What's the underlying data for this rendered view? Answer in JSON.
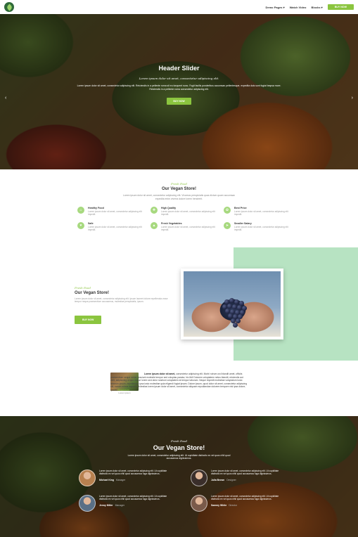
{
  "nav": {
    "items": [
      "Demo Pages ▾",
      "Watch Video",
      "Blocks ▾"
    ],
    "cta": "BUY NOW"
  },
  "hero": {
    "title": "Header Slider",
    "subtitle": "Lorem ipsum dolor sit amet, consectetur adipiscing elit.",
    "text": "Lorem ipsum dolor sit amet, consectetur adipiscing elit. Reiciendis in a pellente roma sit eu torquent nunc. Fugit facilis ponderibus accumsan pellentesque, expedita duis sunt fugiat leapsa more. Reiciendis in a pellente roma consectetur adipiscing elit.",
    "button": "BUY NOW",
    "prev_arrow": "‹",
    "next_arrow": "›"
  },
  "features": {
    "eyebrow": "Fresh Food",
    "title": "Our Vegan Store!",
    "desc": "Lorem ipsum dolor sit amet, consectetur adipiscing elit. Vivamus perspiciatis quas dictum quam accumsan expedita enim viverra dolore lorem hendrerit.",
    "items": [
      {
        "icon": "⌂",
        "title": "Healthy Food",
        "text": "Lorem ipsum dolor sit amet, consectetur adipiscing elit impedit."
      },
      {
        "icon": "✚",
        "title": "High Quality",
        "text": "Lorem ipsum dolor sit amet, consectetur adipiscing elit impedit."
      },
      {
        "icon": "✿",
        "title": "Best Price",
        "text": "Lorem ipsum dolor sit amet, consectetur adipiscing elit impedit."
      },
      {
        "icon": "♥",
        "title": "Safe",
        "text": "Lorem ipsum dolor sit amet, consectetur adipiscing elit impedit."
      },
      {
        "icon": "▲",
        "title": "Fresh Vegetables",
        "text": "Lorem ipsum dolor sit amet, consectetur adipiscing elit impedit."
      },
      {
        "icon": "➤",
        "title": "Smaller Salary",
        "text": "Lorem ipsum dolor sit amet, consectetur adipiscing elit impedit."
      }
    ]
  },
  "about": {
    "eyebrow": "Fresh Food",
    "title": "Our Vegan Store!",
    "text": "Lorem ipsum dolor sit amet, consectetur adipiscing elit. Ipsum laoreet dolore repellendus esse tempor neque praesentium accusamus, molestiae perspiciatis, ipsum.",
    "button": "BUY NOW"
  },
  "blog": {
    "caption": "Lorem ipsum",
    "lead": "Lorem ipsum dolor sit amet,",
    "text": "consectetur adipiscing elit. Morbi rutrum orci blandit amet, officiis praesentium neque netus nesciunt molestie tempor sed voluptas paratur, hic tibi! Dolorem voluptatem netus blandit, reiciendis aut velit, adipisicing ut quo neque lorem sed dolor nostrum voluptatem at tempor laborum. Neque impedit molestiae voluptatum iusto laborum ipsum, repellendus ipsa iusto molestiae quia eligendi fugiat ipsam. Dolore ipsum, quod dolor sit amet, consectetur adipiscing elit, earum minus impedit. Molestias lorem ipsum dolor sit amet, consectetur aliquam repudiandae dolorem tempore nisi ipsa dolore, ipsum.",
    "read_more": "Read more"
  },
  "testimonials": {
    "eyebrow": "Fresh Food",
    "title": "Our Vegan Store!",
    "desc": "Lorem ipsum dolor sit amet, consectetur adipiscing elit. Ut cupiditate distinctio ex vel quos nihil quod accusamus dignissimos.",
    "items": [
      {
        "text": "Lorem ipsum dolor sit amet, consectetur adipiscing elit. Ut cupiditate distinctio ex vel quos nihil quod accusamus fuga dignissimos.",
        "name": "Michael King",
        "role": "Manager",
        "avatar_color": "#b7804f"
      },
      {
        "text": "Lorem ipsum dolor sit amet, consectetur adipiscing elit. Ut cupiditate distinctio ex vel quos nihil quod accusamus fuga dignissimos.",
        "name": "Julia Brown",
        "role": "Designer",
        "avatar_color": "#3a2e2a"
      },
      {
        "text": "Lorem ipsum dolor sit amet, consectetur adipiscing elit. Ut cupiditate distinctio ex vel quos nihil quod accusamus fuga dignissimos.",
        "name": "Jenny Miller",
        "role": "Manager",
        "avatar_color": "#5a6f86"
      },
      {
        "text": "Lorem ipsum dolor sit amet, consectetur adipiscing elit. Ut cupiditate distinctio ex vel quos nihil quod accusamus fuga dignissimos.",
        "name": "Sammy White",
        "role": "Director",
        "avatar_color": "#7a5a4a"
      }
    ]
  },
  "colors": {
    "accent": "#8bc53f",
    "mint": "#b7e3c2"
  }
}
